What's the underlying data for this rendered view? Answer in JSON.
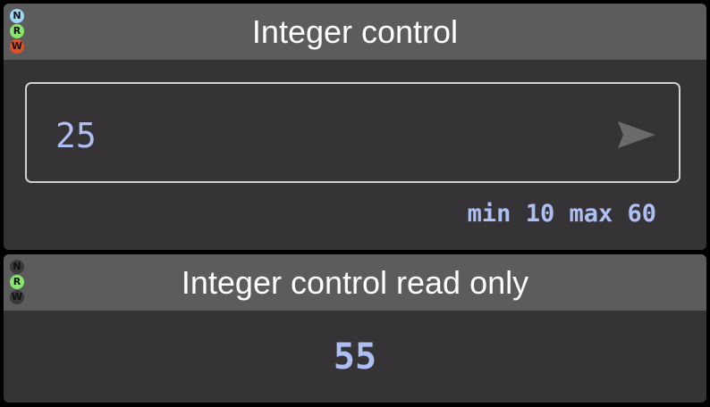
{
  "integer_control": {
    "title": "Integer control",
    "flags": [
      {
        "letter": "N",
        "color": "#9fd8f6"
      },
      {
        "letter": "R",
        "color": "#86e86a"
      },
      {
        "letter": "W",
        "color": "#e2502a"
      }
    ],
    "value": "25",
    "range_text": "min 10 max 60",
    "send_icon": "send-arrow-icon"
  },
  "integer_control_read_only": {
    "title": "Integer control read only",
    "flags": [
      {
        "letter": "N",
        "color": "#3a3a3a"
      },
      {
        "letter": "R",
        "color": "#86e86a"
      },
      {
        "letter": "W",
        "color": "#3a3a3a"
      }
    ],
    "value": "55"
  }
}
